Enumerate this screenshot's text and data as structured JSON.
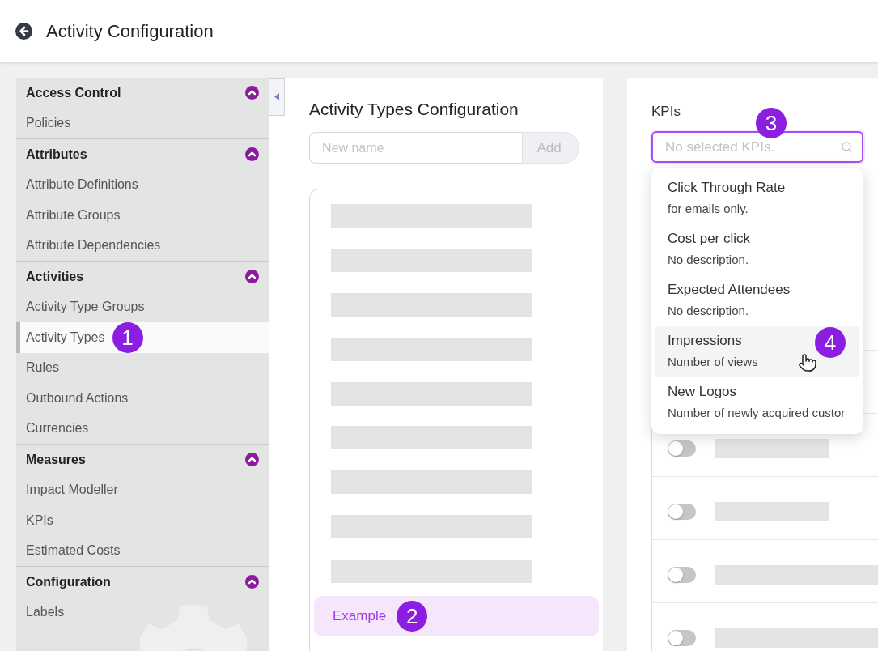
{
  "header": {
    "title": "Activity Configuration"
  },
  "sidebar": {
    "collapsed": false,
    "sections": [
      {
        "title": "Access Control",
        "expanded": true,
        "items": [
          {
            "label": "Policies",
            "selected": false
          }
        ]
      },
      {
        "title": "Attributes",
        "expanded": true,
        "items": [
          {
            "label": "Attribute Definitions",
            "selected": false
          },
          {
            "label": "Attribute Groups",
            "selected": false
          },
          {
            "label": "Attribute Dependencies",
            "selected": false
          }
        ]
      },
      {
        "title": "Activities",
        "expanded": true,
        "items": [
          {
            "label": "Activity Type Groups",
            "selected": false
          },
          {
            "label": "Activity Types",
            "selected": true,
            "callout": "1"
          },
          {
            "label": "Rules",
            "selected": false
          },
          {
            "label": "Outbound Actions",
            "selected": false
          },
          {
            "label": "Currencies",
            "selected": false
          }
        ]
      },
      {
        "title": "Measures",
        "expanded": true,
        "items": [
          {
            "label": "Impact Modeller",
            "selected": false
          },
          {
            "label": "KPIs",
            "selected": false
          },
          {
            "label": "Estimated Costs",
            "selected": false
          }
        ]
      },
      {
        "title": "Configuration",
        "expanded": true,
        "items": [
          {
            "label": "Labels",
            "selected": false
          }
        ]
      }
    ]
  },
  "activity_types": {
    "title": "Activity Types Configuration",
    "name_field": {
      "placeholder": "New name"
    },
    "add_button": {
      "label": "Add",
      "disabled": true
    },
    "items": [
      {
        "kind": "skeleton"
      },
      {
        "kind": "skeleton"
      },
      {
        "kind": "skeleton"
      },
      {
        "kind": "skeleton"
      },
      {
        "kind": "skeleton"
      },
      {
        "kind": "skeleton"
      },
      {
        "kind": "skeleton"
      },
      {
        "kind": "skeleton"
      },
      {
        "kind": "skeleton"
      },
      {
        "kind": "item",
        "label": "Example",
        "selected": true,
        "callout": "2"
      }
    ]
  },
  "kpis": {
    "label": "KPIs",
    "field": {
      "placeholder": "No selected KPIs.",
      "focused": true,
      "callout": "3"
    },
    "dropdown": {
      "open": true,
      "options": [
        {
          "name": "Click Through Rate",
          "description": "for emails only.",
          "highlighted": false
        },
        {
          "name": "Cost per click",
          "description": "No description.",
          "highlighted": false
        },
        {
          "name": "Expected Attendees",
          "description": "No description.",
          "highlighted": false
        },
        {
          "name": "Impressions",
          "description": "Number of views",
          "highlighted": true,
          "callout": "4"
        },
        {
          "name": "New Logos",
          "description": "Number of newly acquired custor",
          "highlighted": false
        }
      ]
    },
    "rows": [
      {
        "kind": "short",
        "on": false
      },
      {
        "kind": "short",
        "on": false
      },
      {
        "kind": "long",
        "on": false
      },
      {
        "kind": "long",
        "on": false
      }
    ]
  }
}
